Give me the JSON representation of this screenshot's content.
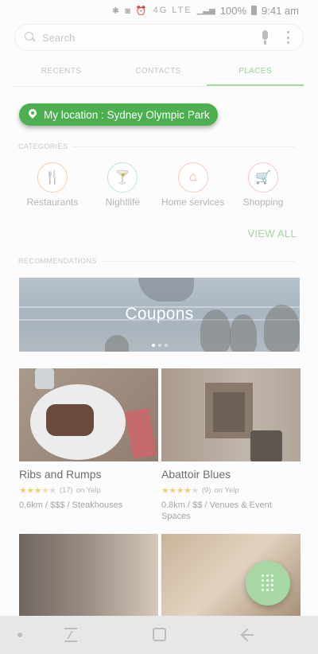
{
  "status_bar": {
    "battery": "100%",
    "time": "9:41 am",
    "network": "4G LTE"
  },
  "search": {
    "placeholder": "Search"
  },
  "tabs": [
    {
      "label": "RECENTS",
      "active": false
    },
    {
      "label": "CONTACTS",
      "active": false
    },
    {
      "label": "PLACES",
      "active": true
    }
  ],
  "location": {
    "label": "My location : Sydney Olympic Park"
  },
  "categories": {
    "header": "CATEGORIES",
    "items": [
      {
        "label": "Restaurants",
        "icon": "fork-knife-icon",
        "color": "#f2b07a"
      },
      {
        "label": "Nightlife",
        "icon": "cocktail-icon",
        "color": "#8fd3c4"
      },
      {
        "label": "Home services",
        "icon": "house-icon",
        "color": "#f0a98f"
      },
      {
        "label": "Shopping",
        "icon": "cart-icon",
        "color": "#f2a4a8"
      }
    ],
    "view_all": "VIEW ALL"
  },
  "recommendations": {
    "header": "RECOMMENDATIONS",
    "banner": "Coupons",
    "cards": [
      {
        "name": "Ribs and Rumps",
        "rating": 3.5,
        "reviews": "(17)",
        "source": "on Yelp",
        "meta": "0.6km / $$$ / Steakhouses"
      },
      {
        "name": "Abattoir Blues",
        "rating": 4,
        "reviews": "(9)",
        "source": "on Yelp",
        "meta": "0.8km / $$ / Venues & Event Spaces"
      }
    ]
  },
  "colors": {
    "accent": "#4caf50",
    "tab_active": "#9bd29a",
    "fab": "#a6d7a4"
  }
}
